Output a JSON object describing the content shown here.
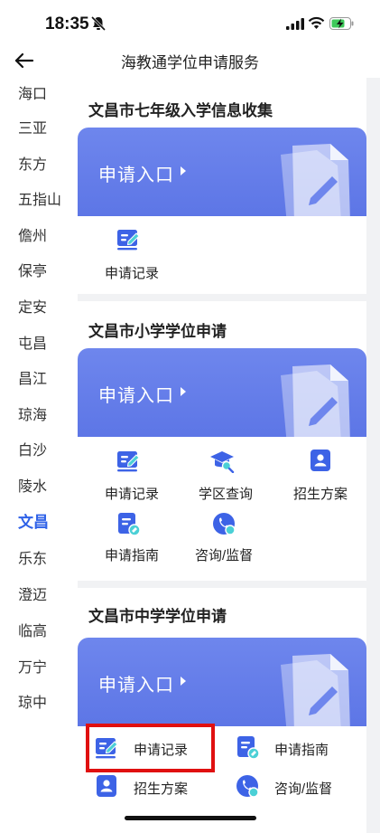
{
  "status": {
    "time": "18:35"
  },
  "nav": {
    "title": "海教通学位申请服务"
  },
  "regions": [
    "海口",
    "三亚",
    "东方",
    "五指山",
    "儋州",
    "保亭",
    "定安",
    "屯昌",
    "昌江",
    "琼海",
    "白沙",
    "陵水",
    "文昌",
    "乐东",
    "澄迈",
    "临高",
    "万宁",
    "琼中"
  ],
  "active_region": "文昌",
  "sections": [
    {
      "title": "文昌市七年级入学信息收集",
      "banner_label": "申请入口",
      "entries": [
        {
          "label": "申请记录",
          "icon": "record-icon"
        }
      ]
    },
    {
      "title": "文昌市小学学位申请",
      "banner_label": "申请入口",
      "entries": [
        {
          "label": "申请记录",
          "icon": "record-icon"
        },
        {
          "label": "学区查询",
          "icon": "school-district-icon"
        },
        {
          "label": "招生方案",
          "icon": "enrollment-plan-icon"
        },
        {
          "label": "申请指南",
          "icon": "guide-icon"
        },
        {
          "label": "咨询/监督",
          "icon": "consult-icon"
        }
      ]
    },
    {
      "title": "文昌市中学学位申请",
      "banner_label": "申请入口",
      "entries": [
        {
          "label": "申请记录",
          "icon": "record-icon"
        },
        {
          "label": "申请指南",
          "icon": "guide-icon"
        },
        {
          "label": "招生方案",
          "icon": "enrollment-plan-icon"
        },
        {
          "label": "咨询/监督",
          "icon": "consult-icon"
        }
      ]
    }
  ],
  "colors": {
    "accent": "#2f62e8",
    "banner": "#6e86ed",
    "highlight": "#e01010",
    "icon_blue": "#3d63e6"
  }
}
